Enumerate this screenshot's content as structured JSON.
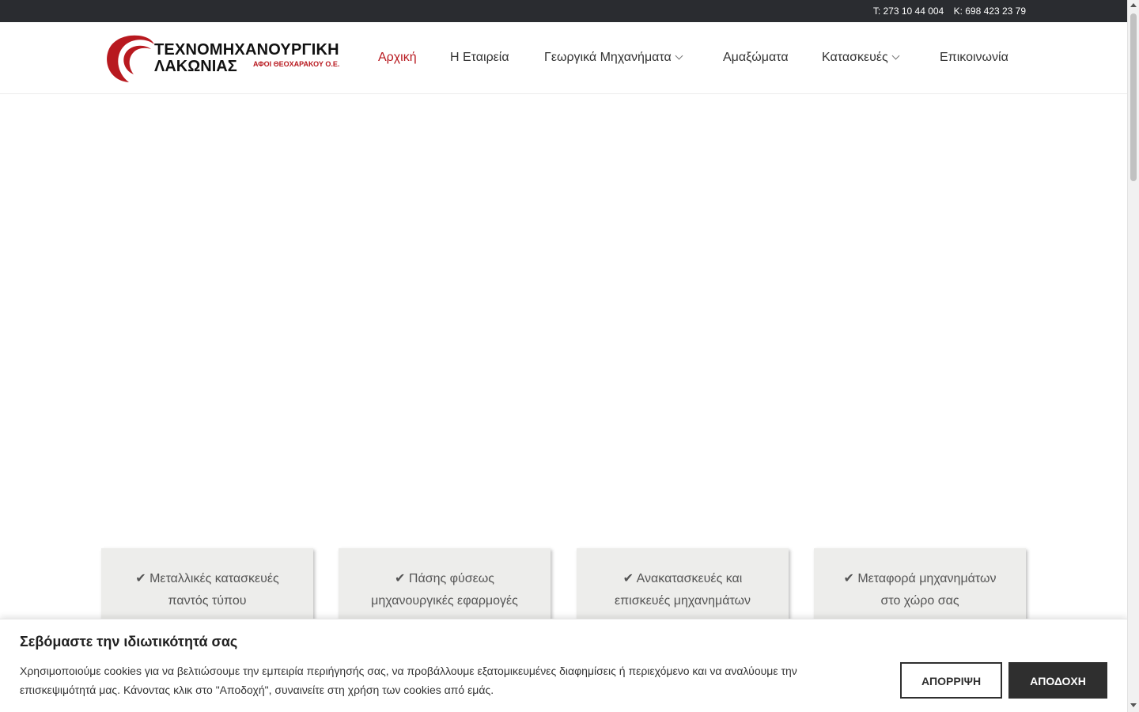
{
  "topbar": {
    "phone": "T: 273 10 44 004",
    "mobile": "K: 698 423 23 79"
  },
  "logo": {
    "line1": "ΤΕΧΝΟΜΗΧΑΝΟΥΡΓΙΚΗ",
    "line2": "ΛΑΚΩΝΙΑΣ",
    "subtitle": "ΑΦΟΙ ΘΕΟΧΑΡΑΚΟΥ Ο.Ε.",
    "accent_color": "#b8191f"
  },
  "nav": {
    "items": [
      {
        "label": "Αρχική",
        "active": true
      },
      {
        "label": "Η Εταιρεία"
      },
      {
        "label": "Γεωργικά Μηχανήματα",
        "icon": "chevron-down-icon"
      },
      {
        "label": "Αμαξώματα"
      },
      {
        "label": "Κατασκευές",
        "icon": "chevron-down-icon"
      },
      {
        "label": "Επικοινωνία"
      }
    ]
  },
  "features": [
    {
      "line1": "✔ Μεταλλικές κατασκευές",
      "line2": "παντός τύπου"
    },
    {
      "line1": "✔ Πάσης φύσεως",
      "line2": "μηχανουργικές εφαρμογές"
    },
    {
      "line1": "✔ Ανακατασκευές και",
      "line2": "επισκευές μηχανημάτων"
    },
    {
      "line1": "✔ Μεταφορά μηχανημάτων",
      "line2": "στο χώρο σας"
    }
  ],
  "cookie": {
    "title": "Σεβόμαστε την ιδιωτικότητά σας",
    "text": "Χρησιμοποιούμε cookies για να βελτιώσουμε την εμπειρία περιήγησής σας, να προβάλλουμε εξατομικευμένες διαφημίσεις ή περιεχόμενο και να αναλύουμε την επισκεψιμότητά μας. Κάνοντας κλικ στο \"Αποδοχή\", συναινείτε στη χρήση των cookies από εμάς.",
    "reject_label": "ΑΠΟΡΡΙΨΗ",
    "accept_label": "ΑΠΟΔΟΧΗ"
  }
}
